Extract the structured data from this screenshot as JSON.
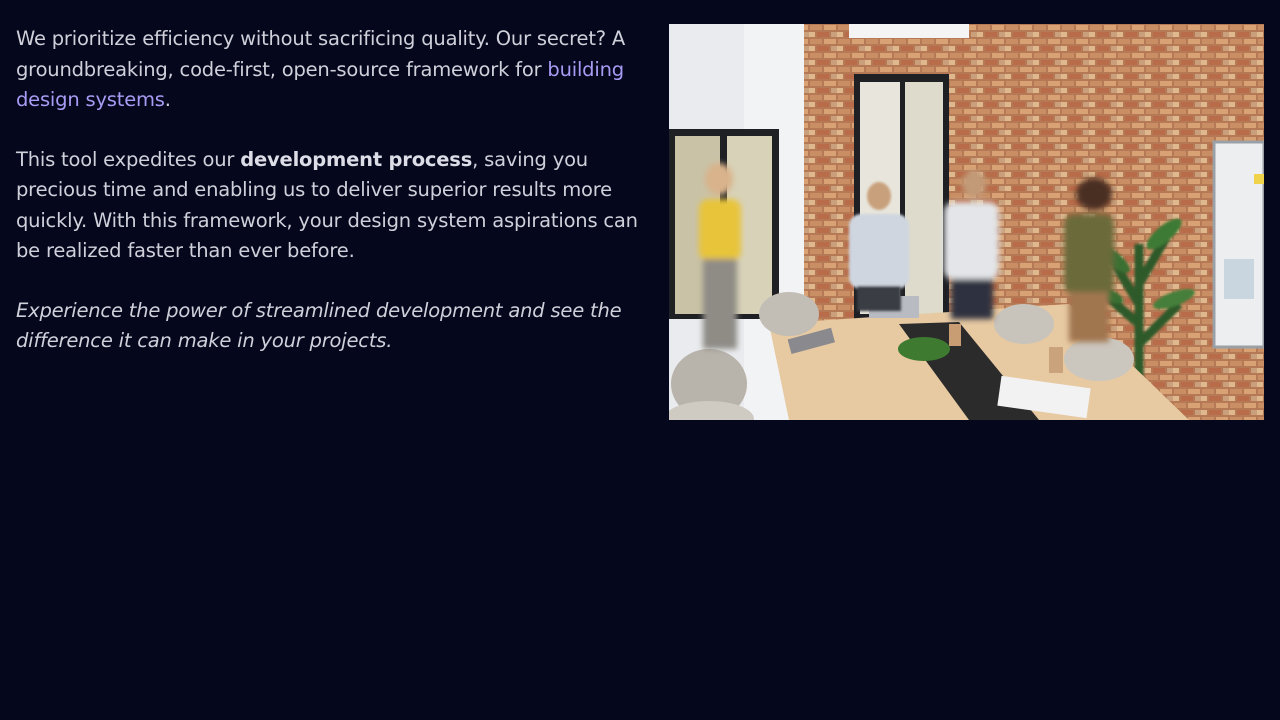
{
  "content": {
    "p1": {
      "text_before": "We prioritize efficiency without sacrificing quality. Our secret? A groundbreaking, code-first, open-source framework for ",
      "link_text": "building design systems",
      "text_after": "."
    },
    "p2": {
      "text_before": "This tool expedites our ",
      "bold_text": "development process",
      "text_after": ", saving you precious time and enabling us to deliver superior results more quickly. With this framework, your design system aspirations can be realized faster than ever before."
    },
    "p3": {
      "text": "Experience the power of streamlined development and see the difference it can make in your projects."
    }
  },
  "colors": {
    "background": "#05071d",
    "text": "#cfd0da",
    "link": "#a89bf4"
  },
  "image": {
    "subject": "office-meeting-photo"
  }
}
